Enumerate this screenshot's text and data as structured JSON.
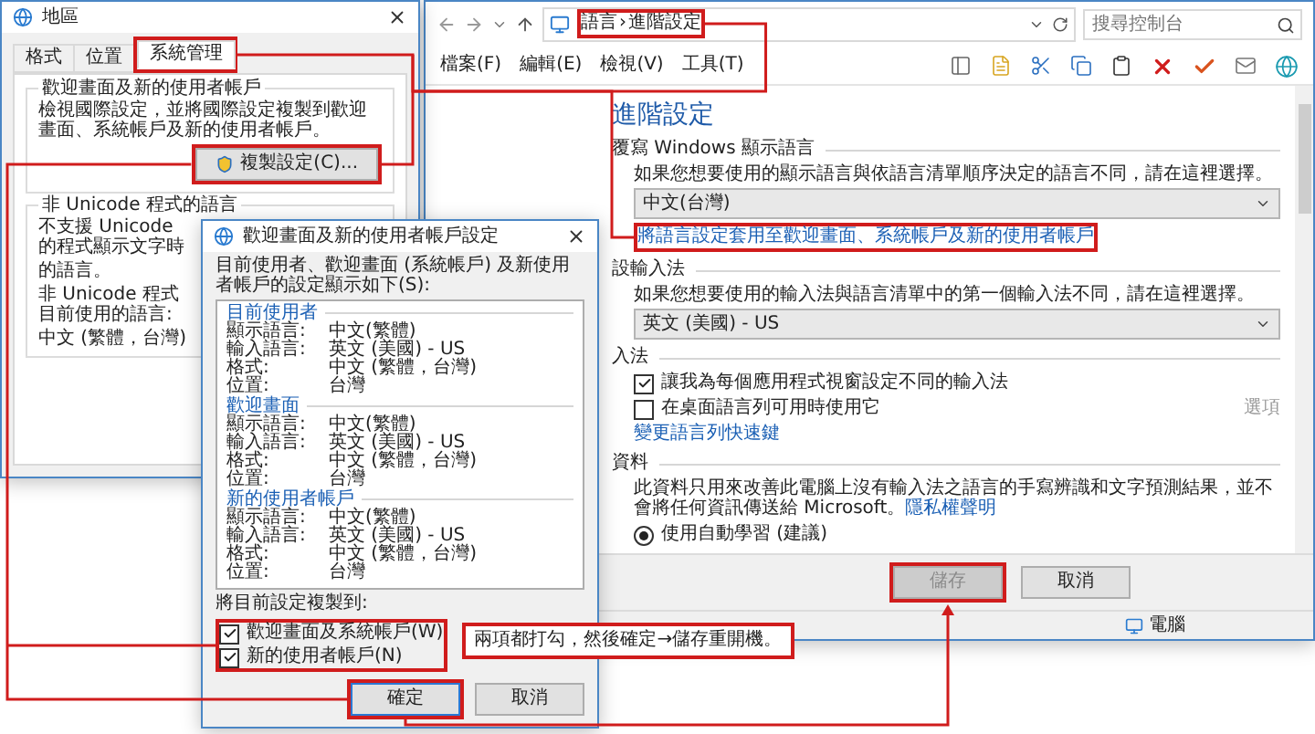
{
  "region_dialog": {
    "title": "地區",
    "tabs": [
      {
        "label": "格式",
        "selected": false,
        "highlighted": false
      },
      {
        "label": "位置",
        "selected": false,
        "highlighted": false
      },
      {
        "label": "系統管理",
        "selected": true,
        "highlighted": true
      }
    ],
    "welcome_group": {
      "title": "歡迎畫面及新的使用者帳戶",
      "text": "檢視國際設定，並將國際設定複製到歡迎畫面、系統帳戶及新的使用者帳戶。",
      "button": {
        "label": "複製設定(C)...",
        "highlighted": true
      }
    },
    "unicode_group": {
      "title": "非 Unicode 程式的語言",
      "text_1": "不支援 Unicode 的程式顯示文字時",
      "text_2": "的語言。",
      "current_label": "非 Unicode 程式目前使用的語言:",
      "current_value": "中文 (繁體，台灣)"
    }
  },
  "control_panel": {
    "breadcrumb": {
      "items": [
        "語言",
        "進階設定"
      ],
      "separator": "›",
      "highlighted": true
    },
    "search": {
      "placeholder": "搜尋控制台"
    },
    "menu": [
      "檔案(F)",
      "編輯(E)",
      "檢視(V)",
      "工具(T)"
    ],
    "heading": "進階設定",
    "sections": [
      {
        "title": "覆寫 Windows 顯示語言",
        "items": [
          {
            "kind": "text",
            "text": "如果您想要使用的顯示語言與依語言清單順序決定的語言不同，請在這裡選擇。"
          },
          {
            "kind": "select",
            "value": "中文(台灣)"
          },
          {
            "kind": "link",
            "text": "將語言設定套用至歡迎畫面、系統帳戶及新的使用者帳戶",
            "highlighted": true
          }
        ]
      },
      {
        "title": "設輸入法",
        "items": [
          {
            "kind": "text",
            "text": "如果您想要使用的輸入法與語言清單中的第一個輸入法不同，請在這裡選擇。"
          },
          {
            "kind": "select",
            "value": "英文 (美國) - US"
          }
        ]
      },
      {
        "title": "入法",
        "items": [
          {
            "kind": "checkbox",
            "label": "讓我為每個應用程式視窗設定不同的輸入法",
            "checked": true
          },
          {
            "kind": "checkbox",
            "label": "在桌面語言列可用時使用它",
            "checked": false,
            "option": {
              "label": "選項",
              "disabled": true
            }
          },
          {
            "kind": "link",
            "text": "變更語言列快速鍵",
            "highlighted": false
          }
        ]
      },
      {
        "title": "資料",
        "items": [
          {
            "kind": "text",
            "text": "此資料只用來改善此電腦上沒有輸入法之語言的手寫辨識和文字預測結果，並不會將任何資訊傳送給 Microsoft。",
            "link": "隱私權聲明"
          },
          {
            "kind": "radio",
            "label": "使用自動學習 (建議)",
            "selected": true
          }
        ]
      }
    ],
    "buttons": [
      {
        "label": "儲存",
        "disabled": true,
        "highlighted": true
      },
      {
        "label": "取消",
        "disabled": false,
        "highlighted": false
      }
    ],
    "status": "電腦"
  },
  "copy_dialog": {
    "title": "歡迎畫面及新的使用者帳戶設定",
    "description": "目前使用者、歡迎畫面 (系統帳戶) 及新使用者帳戶的設定顯示如下(S):",
    "groups": [
      {
        "title": "目前使用者",
        "rows": [
          {
            "label": "顯示語言:",
            "value": "中文(繁體)"
          },
          {
            "label": "輸入語言:",
            "value": "英文 (美國) - US"
          },
          {
            "label": "格式:",
            "value": "中文 (繁體，台灣)"
          },
          {
            "label": "位置:",
            "value": "台灣"
          }
        ]
      },
      {
        "title": "歡迎畫面",
        "rows": [
          {
            "label": "顯示語言:",
            "value": "中文(繁體)"
          },
          {
            "label": "輸入語言:",
            "value": "英文 (美國) - US"
          },
          {
            "label": "格式:",
            "value": "中文 (繁體，台灣)"
          },
          {
            "label": "位置:",
            "value": "台灣"
          }
        ]
      },
      {
        "title": "新的使用者帳戶",
        "rows": [
          {
            "label": "顯示語言:",
            "value": "中文(繁體)"
          },
          {
            "label": "輸入語言:",
            "value": "英文 (美國) - US"
          },
          {
            "label": "格式:",
            "value": "中文 (繁體，台灣)"
          },
          {
            "label": "位置:",
            "value": "台灣"
          }
        ]
      }
    ],
    "copy_to": {
      "label": "將目前設定複製到:",
      "highlighted": true,
      "options": [
        {
          "label": "歡迎畫面及系統帳戶(W)",
          "checked": true
        },
        {
          "label": "新的使用者帳戶(N)",
          "checked": true
        }
      ]
    },
    "buttons": [
      {
        "label": "確定",
        "highlighted": true
      },
      {
        "label": "取消",
        "highlighted": false
      }
    ]
  },
  "callout": "兩項都打勾，然後確定→儲存重開機。"
}
